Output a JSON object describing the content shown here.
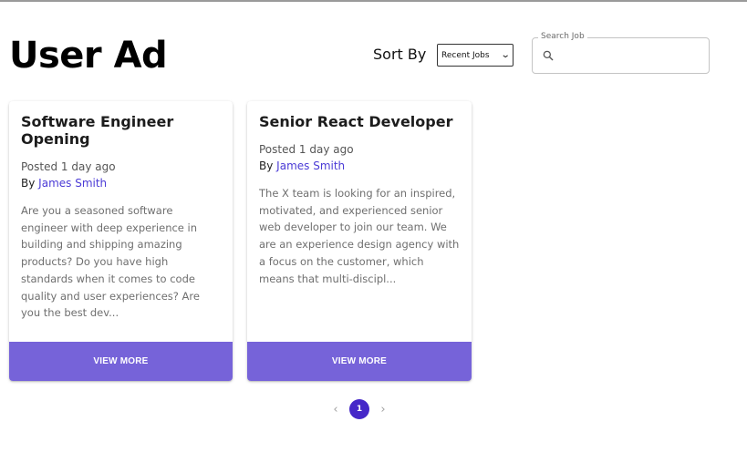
{
  "header": {
    "title": "User Ad",
    "sort_label": "Sort By",
    "sort_value": "Recent Jobs",
    "search_label": "Search Job",
    "search_value": ""
  },
  "jobs": [
    {
      "title": "Software Engineer Opening",
      "posted": "Posted 1 day ago",
      "by_prefix": "By",
      "author": "James Smith",
      "description": "Are you a seasoned software engineer with deep experience in building and shipping amazing products? Do you have high standards when it comes to code quality and user experiences? Are you the best dev...",
      "button_label": "VIEW MORE"
    },
    {
      "title": "Senior React Developer",
      "posted": "Posted 1 day ago",
      "by_prefix": "By",
      "author": "James Smith",
      "description": "The X team is looking for an inspired, motivated, and experienced senior web developer to join our team. We are an experience design agency with a focus on the customer, which means that multi-discipl...",
      "button_label": "VIEW MORE"
    }
  ],
  "pagination": {
    "prev_icon": "chevron-left-icon",
    "next_icon": "chevron-right-icon",
    "current_page": "1"
  },
  "colors": {
    "accent": "#7663d9",
    "page_active": "#4527c8",
    "link": "#4b3bd6"
  }
}
